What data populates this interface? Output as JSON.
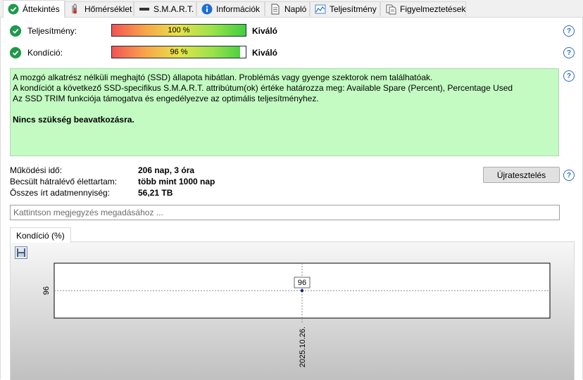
{
  "tabs": [
    {
      "label": "Áttekintés",
      "icon": "check-circle-icon"
    },
    {
      "label": "Hőmérséklet",
      "icon": "thermometer-icon"
    },
    {
      "label": "S.M.A.R.T.",
      "icon": "drive-icon"
    },
    {
      "label": "Információk",
      "icon": "info-icon"
    },
    {
      "label": "Napló",
      "icon": "document-icon"
    },
    {
      "label": "Teljesítmény",
      "icon": "performance-chart-icon"
    },
    {
      "label": "Figyelmeztetések",
      "icon": "alerts-icon"
    }
  ],
  "performance": {
    "label": "Teljesítmény:",
    "value": "100 %",
    "level": 1.0,
    "rating": "Kiváló"
  },
  "condition": {
    "label": "Kondíció:",
    "value": "96 %",
    "level": 0.96,
    "rating": "Kiváló"
  },
  "status": {
    "line1": "A mozgó alkatrész nélküli meghajtó (SSD) állapota hibátlan. Problémás vagy gyenge szektorok nem találhatóak.",
    "line2": "A kondíciót a következő SSD-specifikus S.M.A.R.T. attribútum(ok) értéke határozza meg:  Available Spare (Percent), Percentage Used",
    "line3": "Az SSD TRIM funkciója támogatva és engedélyezve az optimális teljesítményhez.",
    "conclusion": "Nincs szükség beavatkozásra."
  },
  "stats": [
    {
      "label": "Működési idő:",
      "value": "206 nap, 3 óra"
    },
    {
      "label": "Becsült hátralévő élettartam:",
      "value": "több mint 1000 nap"
    },
    {
      "label": "Összes írt adatmennyiség:",
      "value": "56,21 TB"
    }
  ],
  "retest_button": "Újratesztelés",
  "note": {
    "placeholder": "Kattintson megjegyzés megadásához ..."
  },
  "chart_tab": "Kondíció  (%)",
  "chart_data": {
    "type": "line",
    "x": [
      "2025.10.26."
    ],
    "series": [
      {
        "values": [
          96
        ]
      }
    ],
    "ytick_labels": [
      "96"
    ],
    "xtick_labels": [
      "2025.10.26."
    ],
    "data_labels": [
      "96"
    ]
  }
}
